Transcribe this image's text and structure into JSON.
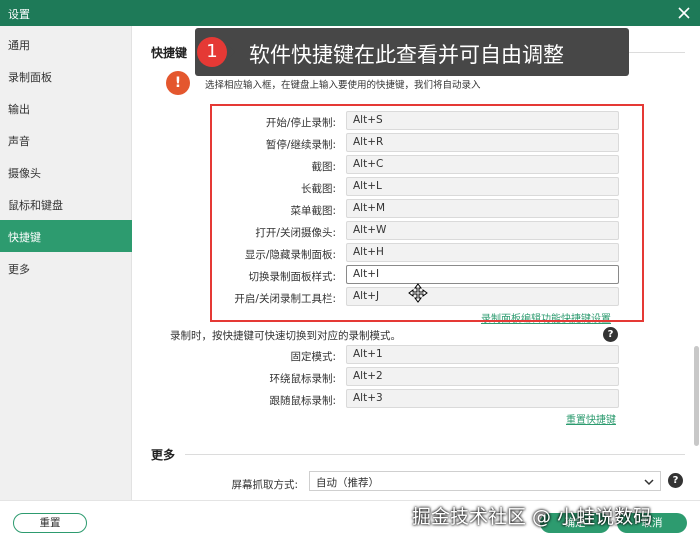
{
  "window": {
    "title": "设置"
  },
  "sidebar": {
    "items": [
      {
        "label": "通用"
      },
      {
        "label": "录制面板"
      },
      {
        "label": "输出"
      },
      {
        "label": "声音"
      },
      {
        "label": "摄像头"
      },
      {
        "label": "鼠标和键盘"
      },
      {
        "label": "快捷键",
        "active": true
      },
      {
        "label": "更多"
      }
    ]
  },
  "shortcuts": {
    "title": "快捷键",
    "hint": "选择相应输入框，在键盘上输入要使用的快捷键，我们将自动录入",
    "rows": [
      {
        "label": "开始/停止录制:",
        "value": "Alt+S"
      },
      {
        "label": "暂停/继续录制:",
        "value": "Alt+R"
      },
      {
        "label": "截图:",
        "value": "Alt+C"
      },
      {
        "label": "长截图:",
        "value": "Alt+L"
      },
      {
        "label": "菜单截图:",
        "value": "Alt+M"
      },
      {
        "label": "打开/关闭摄像头:",
        "value": "Alt+W"
      },
      {
        "label": "显示/隐藏录制面板:",
        "value": "Alt+H"
      },
      {
        "label": "切换录制面板样式:",
        "value": "Alt+I"
      },
      {
        "label": "开启/关闭录制工具栏:",
        "value": "Alt+J"
      }
    ],
    "panel_link": "录制面板编辑功能快捷键设置",
    "mode_hint": "录制时，按快捷键可快速切换到对应的录制模式。",
    "mode_rows": [
      {
        "label": "固定模式:",
        "value": "Alt+1"
      },
      {
        "label": "环绕鼠标录制:",
        "value": "Alt+2"
      },
      {
        "label": "跟随鼠标录制:",
        "value": "Alt+3"
      }
    ],
    "reset_link": "重置快捷键"
  },
  "more": {
    "title": "更多",
    "capture_label": "屏幕抓取方式:",
    "capture_value": "自动（推荐）"
  },
  "footer": {
    "reset": "重置",
    "ok": "确定",
    "cancel": "取消"
  },
  "callout": {
    "number": "1",
    "text": "软件快捷键在此查看并可自由调整"
  },
  "watermark": "掘金技术社区 @ 小蛙说数码",
  "colors": {
    "accent": "#2d9b6f",
    "titlebar": "#1e7a58",
    "highlight_box": "#e53935",
    "callout_bg": "#474747",
    "warn": "#e4572e"
  }
}
